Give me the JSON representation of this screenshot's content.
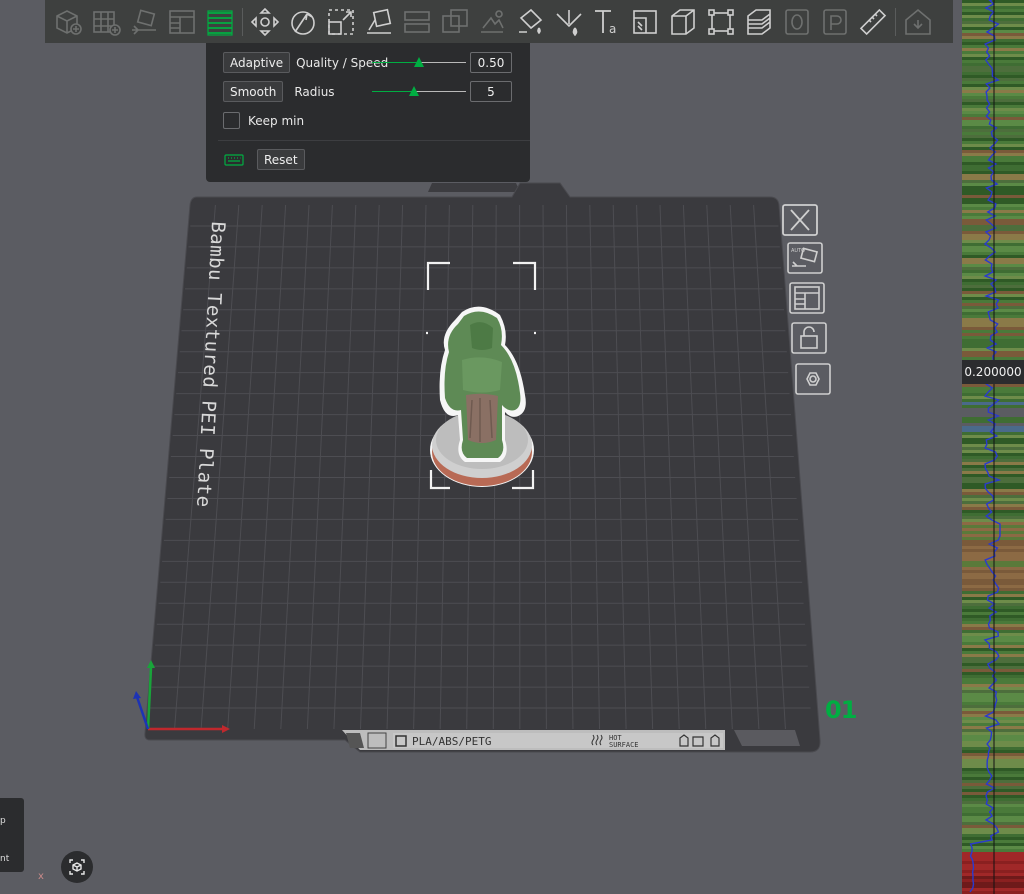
{
  "toolbar": {
    "items": [
      "add-icon",
      "arrange-grid-icon",
      "auto-orient-icon",
      "layout-icon",
      "layers-icon",
      "move-icon",
      "rotate-icon",
      "scale-icon",
      "lay-on-face-icon",
      "split-objects-icon",
      "split-parts-icon",
      "boolean-icon",
      "support-paint-icon",
      "seam-paint-icon",
      "text-icon",
      "measure-cut-icon",
      "cube-icon",
      "resize-icon",
      "variable-layer-height-icon",
      "assemble-icon",
      "place-icon",
      "ruler-icon",
      "plate-settings-icon"
    ]
  },
  "panel": {
    "adaptive_button": "Adaptive",
    "quality_label": "Quality / Speed",
    "quality_value": "0.50",
    "quality_fraction": 0.5,
    "smooth_button": "Smooth",
    "radius_label": "Radius",
    "radius_value": "5",
    "radius_fraction": 0.45,
    "keep_min_label": "Keep min",
    "reset_button": "Reset"
  },
  "plate": {
    "name": "Bambu Textured PEI Plate",
    "number": "01",
    "material_strip": "PLA/ABS/PETG",
    "hot_surface": "HOT\nSURFACE"
  },
  "side_tools": [
    "close-plate-icon",
    "auto-orient-plate-icon",
    "arrange-plate-icon",
    "lock-plate-icon",
    "plate-settings-hex-icon"
  ],
  "layer_slider": {
    "value": "0.200000"
  },
  "bottom_left": {
    "line1": "p",
    "line2": "nt",
    "axis_label": "x"
  },
  "colors": {
    "accent": "#00ae42",
    "plate": "#3a3a3e",
    "panel": "#2b2c2e",
    "toolbar": "#3e403f",
    "background": "#5b5c62"
  }
}
